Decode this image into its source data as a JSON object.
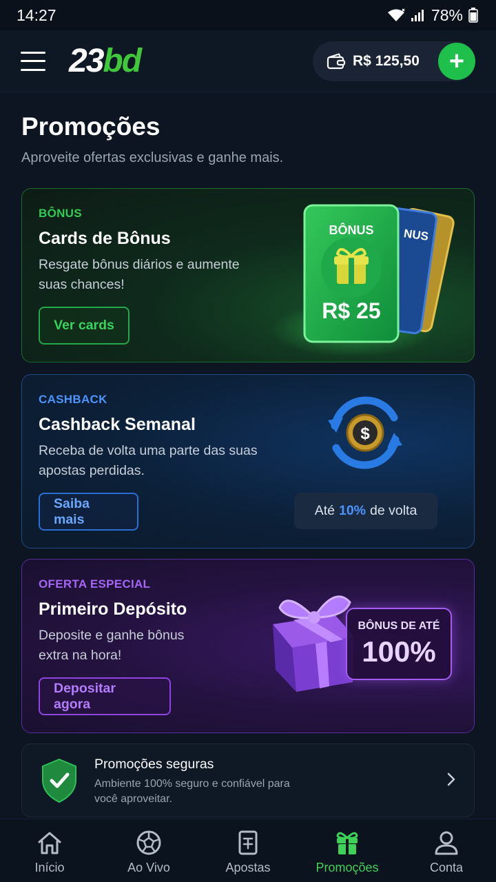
{
  "status": {
    "time": "14:27",
    "battery": "78%"
  },
  "header": {
    "logo_num": "23",
    "logo_bd": "bd",
    "balance": "R$ 125,50",
    "add_label": "+"
  },
  "page": {
    "title": "Promoções",
    "subtitle": "Aproveite ofertas exclusivas e ganhe mais."
  },
  "cards": {
    "bonus": {
      "tag": "BÔNUS",
      "title": "Cards de Bônus",
      "desc": "Resgate bônus diários e aumente suas chances!",
      "button": "Ver cards",
      "card_label": "BÔNUS",
      "card_value": "R$ 25",
      "back_label": "NUS"
    },
    "cashback": {
      "tag": "CASHBACK",
      "title": "Cashback Semanal",
      "desc": "Receba de volta uma parte das suas apostas perdidas.",
      "button": "Saiba mais",
      "pill_prefix": "Até",
      "pill_value": "10%",
      "pill_suffix": "de volta"
    },
    "offer": {
      "tag": "OFERTA ESPECIAL",
      "title": "Primeiro Depósito",
      "desc": "Deposite e ganhe bônus extra na hora!",
      "button": "Depositar agora",
      "box_small": "BÔNUS DE ATÉ",
      "box_big": "100%"
    }
  },
  "secure": {
    "title": "Promoções seguras",
    "desc": "Ambiente 100% seguro e confiável para você aproveitar."
  },
  "nav": [
    {
      "label": "Início",
      "icon": "home-icon"
    },
    {
      "label": "Ao Vivo",
      "icon": "soccer-ball-icon"
    },
    {
      "label": "Apostas",
      "icon": "bet-slip-icon"
    },
    {
      "label": "Promoções",
      "icon": "gift-icon",
      "active": true
    },
    {
      "label": "Conta",
      "icon": "user-icon"
    }
  ],
  "colors": {
    "accent_green": "#1ec04b",
    "accent_blue": "#4a95ff",
    "accent_purple": "#a565f5",
    "background": "#0c1521"
  }
}
